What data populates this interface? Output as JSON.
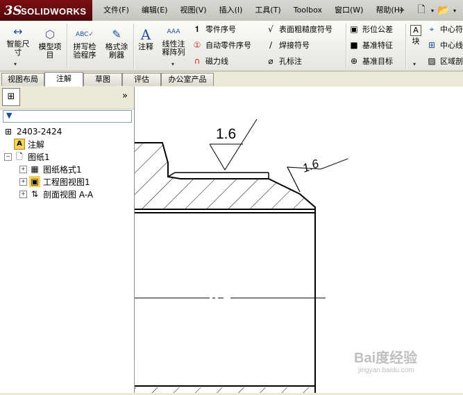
{
  "app": {
    "logo_mark": "3S",
    "name": "SOLIDWORKS"
  },
  "menu": [
    "文件(F)",
    "编辑(E)",
    "视图(V)",
    "插入(I)",
    "工具(T)",
    "Toolbox",
    "窗口(W)",
    "帮助(H)"
  ],
  "ribbon": {
    "smart_dim": "智能尺\n寸",
    "model_items": "模型项\n目",
    "spell_check": "拼写检\n验程序",
    "format_painter": "格式涂\n刷器",
    "note": "注释",
    "linear_note_pattern": "线性注\n释阵列",
    "balloon": "零件序号",
    "auto_balloon": "自动零件序号",
    "magnetic_line": "磁力线",
    "surface_finish": "表面粗糙度符号",
    "weld_symbol": "焊接符号",
    "hole_callout": "孔标注",
    "gtol": "形位公差",
    "datum_feature": "基准特征",
    "datum_target": "基准目标",
    "block": "块",
    "centermark": "中心符",
    "centerline": "中心线",
    "area_hatch": "区域剖"
  },
  "tabs": [
    "视图布局",
    "注解",
    "草图",
    "评估",
    "办公室产品"
  ],
  "active_tab": "注解",
  "tree": {
    "root": "2403-2424",
    "annotations": "注解",
    "sheet": "图纸1",
    "sheet_format": "图纸格式1",
    "drawing_view": "工程图视图1",
    "section_view": "剖面视图 A-A"
  },
  "drawing": {
    "roughness_left": "1.6",
    "roughness_right": "1.6"
  },
  "watermark": {
    "brand": "Bai度经验",
    "url": "jingyan.baidu.com"
  }
}
